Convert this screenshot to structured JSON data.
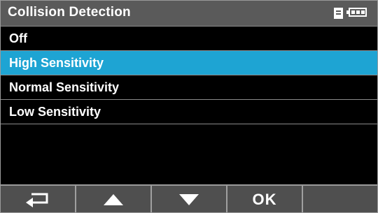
{
  "title": "Collision Detection",
  "status_icons": [
    "sd-card-icon",
    "battery-icon"
  ],
  "menu": {
    "items": [
      {
        "label": "Off",
        "selected": false
      },
      {
        "label": "High Sensitivity",
        "selected": true
      },
      {
        "label": "Normal Sensitivity",
        "selected": false
      },
      {
        "label": "Low Sensitivity",
        "selected": false
      }
    ]
  },
  "bottom_bar": {
    "buttons": [
      {
        "name": "back-button",
        "icon": "return-arrow-icon"
      },
      {
        "name": "up-button",
        "icon": "up-triangle-icon"
      },
      {
        "name": "down-button",
        "icon": "down-triangle-icon"
      },
      {
        "name": "ok-button",
        "label": "OK"
      },
      {
        "name": "blank-button"
      }
    ]
  },
  "colors": {
    "title_bar": "#5a5a5a",
    "selected_item": "#1ea4d3",
    "background": "#000000",
    "bottom_bar": "#4f4f4f"
  }
}
